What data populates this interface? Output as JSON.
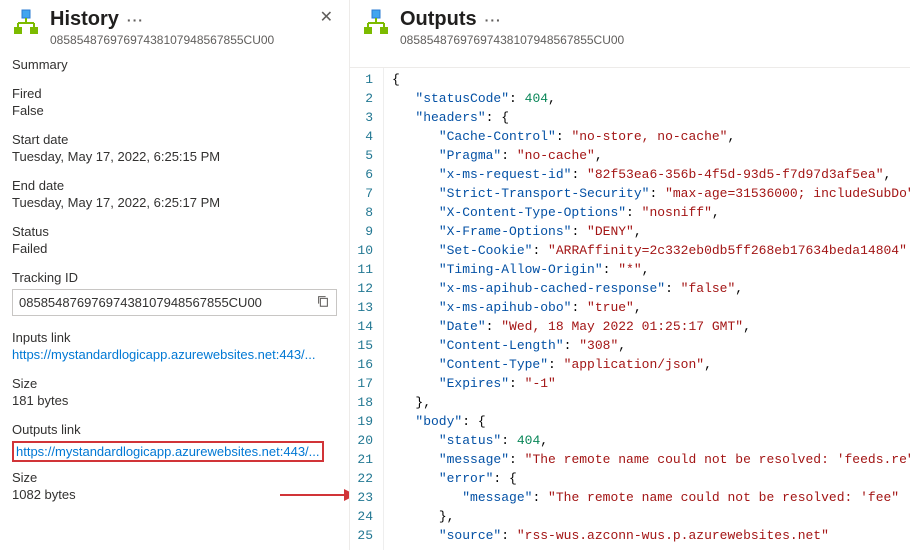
{
  "history": {
    "title": "History",
    "run_id": "08585487697697438107948567855CU00",
    "summary_label": "Summary",
    "fired_label": "Fired",
    "fired_value": "False",
    "start_label": "Start date",
    "start_value": "Tuesday, May 17, 2022, 6:25:15 PM",
    "end_label": "End date",
    "end_value": "Tuesday, May 17, 2022, 6:25:17 PM",
    "status_label": "Status",
    "status_value": "Failed",
    "tracking_label": "Tracking ID",
    "tracking_value": "08585487697697438107948567855CU00",
    "inputs_link_label": "Inputs link",
    "inputs_link_value": "https://mystandardlogicapp.azurewebsites.net:443/...",
    "inputs_size_label": "Size",
    "inputs_size_value": "181 bytes",
    "outputs_link_label": "Outputs link",
    "outputs_link_value": "https://mystandardlogicapp.azurewebsites.net:443/...",
    "outputs_size_label": "Size",
    "outputs_size_value": "1082 bytes"
  },
  "outputs": {
    "title": "Outputs",
    "run_id": "08585487697697438107948567855CU00",
    "json": {
      "statusCode": 404,
      "headers": {
        "Cache-Control": "no-store, no-cache",
        "Pragma": "no-cache",
        "x-ms-request-id": "82f53ea6-356b-4f5d-93d5-f7d97d3af5ea",
        "Strict-Transport-Security": "max-age=31536000; includeSubDo",
        "X-Content-Type-Options": "nosniff",
        "X-Frame-Options": "DENY",
        "Set-Cookie": "ARRAffinity=2c332eb0db5ff268eb17634beda14804",
        "Timing-Allow-Origin": "*",
        "x-ms-apihub-cached-response": "false",
        "x-ms-apihub-obo": "true",
        "Date": "Wed, 18 May 2022 01:25:17 GMT",
        "Content-Length": "308",
        "Content-Type": "application/json",
        "Expires": "-1"
      },
      "body": {
        "status": 404,
        "message": "The remote name could not be resolved: 'feeds.re",
        "error": {
          "message": "The remote name could not be resolved: 'fee"
        },
        "source": "rss-wus.azconn-wus.p.azurewebsites.net"
      }
    },
    "lines": [
      {
        "n": 1,
        "ind": 0,
        "kind": "brace",
        "text": "{"
      },
      {
        "n": 2,
        "ind": 1,
        "kind": "kv-num",
        "key": "statusCode",
        "val": "404",
        "comma": true
      },
      {
        "n": 3,
        "ind": 1,
        "kind": "kv-open",
        "key": "headers"
      },
      {
        "n": 4,
        "ind": 2,
        "kind": "kv-str",
        "key": "Cache-Control",
        "val": "no-store, no-cache",
        "comma": true
      },
      {
        "n": 5,
        "ind": 2,
        "kind": "kv-str",
        "key": "Pragma",
        "val": "no-cache",
        "comma": true
      },
      {
        "n": 6,
        "ind": 2,
        "kind": "kv-str",
        "key": "x-ms-request-id",
        "val": "82f53ea6-356b-4f5d-93d5-f7d97d3af5ea",
        "comma": true
      },
      {
        "n": 7,
        "ind": 2,
        "kind": "kv-str",
        "key": "Strict-Transport-Security",
        "val": "max-age=31536000; includeSubDo"
      },
      {
        "n": 8,
        "ind": 2,
        "kind": "kv-str",
        "key": "X-Content-Type-Options",
        "val": "nosniff",
        "comma": true
      },
      {
        "n": 9,
        "ind": 2,
        "kind": "kv-str",
        "key": "X-Frame-Options",
        "val": "DENY",
        "comma": true
      },
      {
        "n": 10,
        "ind": 2,
        "kind": "kv-str",
        "key": "Set-Cookie",
        "val": "ARRAffinity=2c332eb0db5ff268eb17634beda14804"
      },
      {
        "n": 11,
        "ind": 2,
        "kind": "kv-str",
        "key": "Timing-Allow-Origin",
        "val": "*",
        "comma": true
      },
      {
        "n": 12,
        "ind": 2,
        "kind": "kv-str",
        "key": "x-ms-apihub-cached-response",
        "val": "false",
        "comma": true
      },
      {
        "n": 13,
        "ind": 2,
        "kind": "kv-str",
        "key": "x-ms-apihub-obo",
        "val": "true",
        "comma": true
      },
      {
        "n": 14,
        "ind": 2,
        "kind": "kv-str",
        "key": "Date",
        "val": "Wed, 18 May 2022 01:25:17 GMT",
        "comma": true
      },
      {
        "n": 15,
        "ind": 2,
        "kind": "kv-str",
        "key": "Content-Length",
        "val": "308",
        "comma": true
      },
      {
        "n": 16,
        "ind": 2,
        "kind": "kv-str",
        "key": "Content-Type",
        "val": "application/json",
        "comma": true
      },
      {
        "n": 17,
        "ind": 2,
        "kind": "kv-str",
        "key": "Expires",
        "val": "-1"
      },
      {
        "n": 18,
        "ind": 1,
        "kind": "close",
        "comma": true
      },
      {
        "n": 19,
        "ind": 1,
        "kind": "kv-open",
        "key": "body"
      },
      {
        "n": 20,
        "ind": 2,
        "kind": "kv-num",
        "key": "status",
        "val": "404",
        "comma": true
      },
      {
        "n": 21,
        "ind": 2,
        "kind": "kv-str",
        "key": "message",
        "val": "The remote name could not be resolved: 'feeds.re"
      },
      {
        "n": 22,
        "ind": 2,
        "kind": "kv-open",
        "key": "error"
      },
      {
        "n": 23,
        "ind": 3,
        "kind": "kv-str",
        "key": "message",
        "val": "The remote name could not be resolved: 'fee"
      },
      {
        "n": 24,
        "ind": 2,
        "kind": "close",
        "comma": true
      },
      {
        "n": 25,
        "ind": 2,
        "kind": "kv-str",
        "key": "source",
        "val": "rss-wus.azconn-wus.p.azurewebsites.net"
      }
    ]
  }
}
